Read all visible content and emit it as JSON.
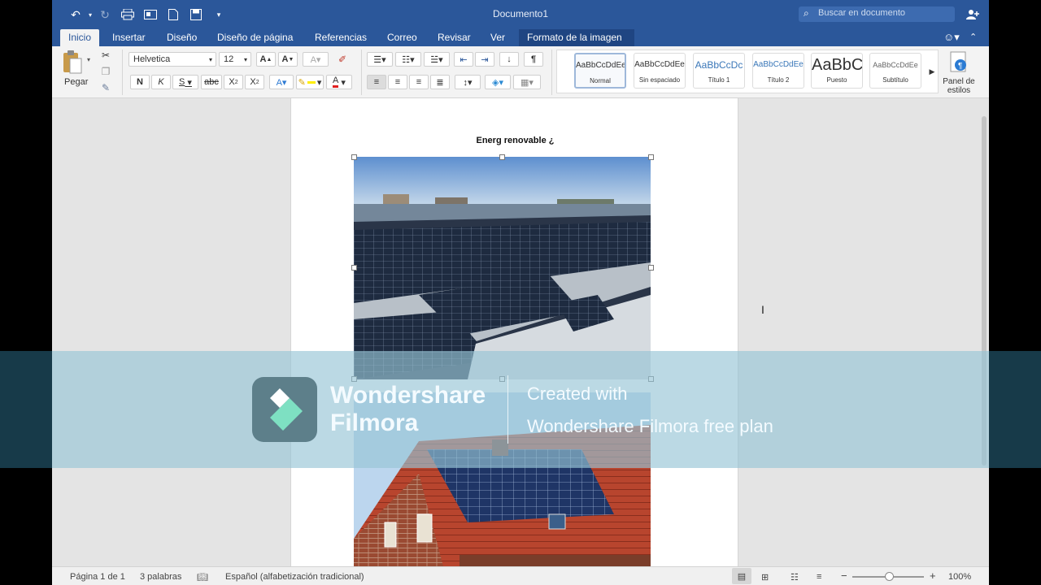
{
  "window": {
    "title": "Documento1",
    "search_placeholder": "Buscar en documento"
  },
  "tabs": [
    {
      "label": "Inicio",
      "active": true
    },
    {
      "label": "Insertar"
    },
    {
      "label": "Diseño"
    },
    {
      "label": "Diseño de página"
    },
    {
      "label": "Referencias"
    },
    {
      "label": "Correo"
    },
    {
      "label": "Revisar"
    },
    {
      "label": "Ver"
    },
    {
      "label": "Formato de la imagen",
      "contextual": true
    }
  ],
  "ribbon": {
    "paste_label": "Pegar",
    "font_name": "Helvetica",
    "font_size": "12",
    "bold": "N",
    "italic": "K",
    "underline": "S",
    "strike": "abc",
    "grow": "A",
    "shrink": "A",
    "pilcrow": "¶",
    "styles_pane_label": "Panel de estilos",
    "styles": [
      {
        "preview": "AaBbCcDdEe",
        "name": "Normal"
      },
      {
        "preview": "AaBbCcDdEe",
        "name": "Sin espaciado"
      },
      {
        "preview": "AaBbCcDc",
        "name": "Título 1"
      },
      {
        "preview": "AaBbCcDdEe",
        "name": "Título 2"
      },
      {
        "preview": "AaBbC",
        "name": "Puesto"
      },
      {
        "preview": "AaBbCcDdEe",
        "name": "Subtítulo"
      }
    ]
  },
  "document": {
    "heading": "Energ renovable ¿"
  },
  "status": {
    "page": "Página 1 de 1",
    "words": "3 palabras",
    "language": "Español (alfabetización tradicional)",
    "zoom": "100%"
  },
  "watermark": {
    "brand_line1": "Wondershare",
    "brand_line2": "Filmora",
    "created_line1": "Created with",
    "created_line2": "Wondershare Filmora free plan"
  },
  "colors": {
    "accent": "#2b579a",
    "overlay": "#96c4d6",
    "highlight": "#ffee00",
    "font_color": "#e02020"
  }
}
